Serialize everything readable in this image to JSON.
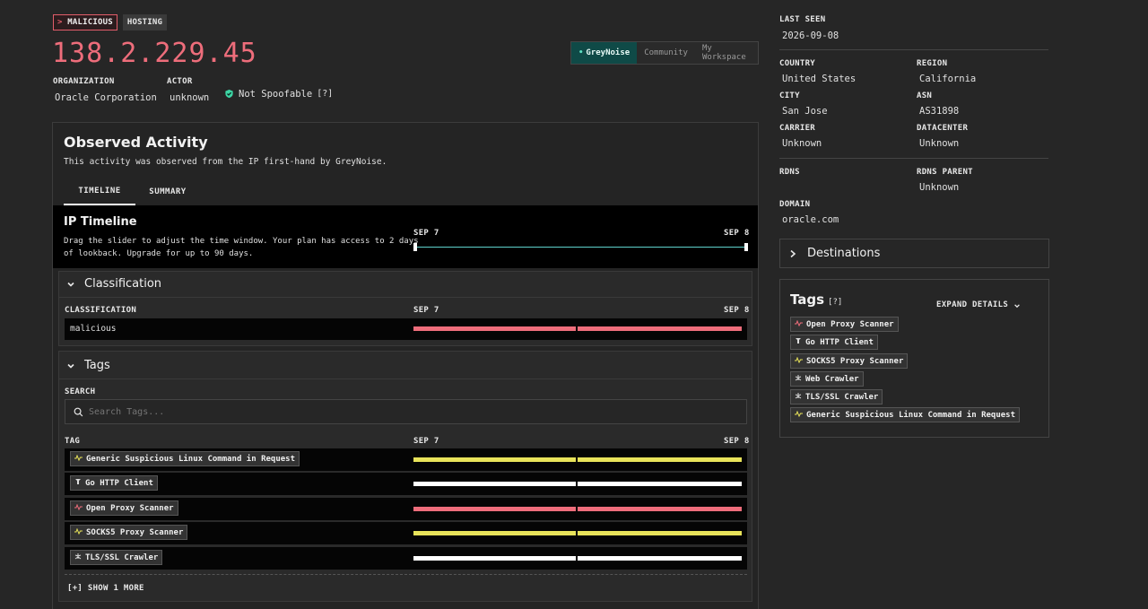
{
  "badges": {
    "malicious": "MALICIOUS",
    "malicious_prefix": ">",
    "hosting": "HOSTING"
  },
  "ip": "138.2.229.45",
  "sources": {
    "greynoise": "GreyNoise",
    "community": "Community",
    "workspace": "My Workspace",
    "active": "GreyNoise"
  },
  "organization": {
    "label": "ORGANIZATION",
    "value": "Oracle Corporation"
  },
  "actor": {
    "label": "ACTOR",
    "value": "unknown"
  },
  "spoofable": {
    "label": "Not Spoofable",
    "help": "[?]"
  },
  "observed": {
    "title": "Observed Activity",
    "subtitle": "This activity was observed from the IP first-hand by GreyNoise.",
    "tabs": [
      "TIMELINE",
      "SUMMARY"
    ]
  },
  "timeline": {
    "title": "IP Timeline",
    "desc_line1": "Drag the slider to adjust the time window. Your plan has access to 2 days",
    "desc_line2": "of lookback. Upgrade for up to 90 days.",
    "start": "SEP 7",
    "end": "SEP 8"
  },
  "classification": {
    "section_title": "Classification",
    "col_label": "CLASSIFICATION",
    "start": "SEP 7",
    "end": "SEP 8",
    "value": "malicious"
  },
  "tags_section": {
    "title": "Tags",
    "search_label": "SEARCH",
    "search_placeholder": "Search Tags...",
    "col_label": "TAG",
    "start": "SEP 7",
    "end": "SEP 8",
    "rows": [
      {
        "name": "Generic Suspicious Linux Command in Request",
        "color": "#e8e35a",
        "icon": "activity-icon"
      },
      {
        "name": "Go HTTP Client",
        "color": "#ffffff",
        "icon": "tool-icon"
      },
      {
        "name": "Open Proxy Scanner",
        "color": "#ee6d7b",
        "icon": "pulse-icon"
      },
      {
        "name": "SOCKS5 Proxy Scanner",
        "color": "#e8e35a",
        "icon": "activity-icon"
      },
      {
        "name": "TLS/SSL Crawler",
        "color": "#ffffff",
        "icon": "spider-icon"
      }
    ],
    "show_more": "[+] SHOW 1 MORE"
  },
  "right": {
    "last_seen": {
      "label": "LAST SEEN",
      "value": "2026-09-08"
    },
    "country": {
      "label": "COUNTRY",
      "value": "United States"
    },
    "region": {
      "label": "REGION",
      "value": "California"
    },
    "city": {
      "label": "CITY",
      "value": "San Jose"
    },
    "asn": {
      "label": "ASN",
      "value": "AS31898"
    },
    "carrier": {
      "label": "CARRIER",
      "value": "Unknown"
    },
    "datacenter": {
      "label": "DATACENTER",
      "value": "Unknown"
    },
    "rdns": {
      "label": "RDNS",
      "value": ""
    },
    "rdns_parent": {
      "label": "RDNS PARENT",
      "value": "Unknown"
    },
    "domain": {
      "label": "DOMAIN",
      "value": "oracle.com"
    },
    "destinations": "Destinations",
    "tags": {
      "title": "Tags",
      "help": "[?]",
      "expand": "EXPAND DETAILS",
      "items": [
        {
          "name": "Open Proxy Scanner",
          "icon": "pulse-icon"
        },
        {
          "name": "Go HTTP Client",
          "icon": "tool-icon"
        },
        {
          "name": "SOCKS5 Proxy Scanner",
          "icon": "activity-icon"
        },
        {
          "name": "Web Crawler",
          "icon": "spider-icon"
        },
        {
          "name": "TLS/SSL Crawler",
          "icon": "spider-icon"
        },
        {
          "name": "Generic Suspicious Linux Command in Request",
          "icon": "activity-icon"
        }
      ]
    }
  },
  "colors": {
    "malicious": "#ee6d7b",
    "accent": "#0f4a47",
    "suspicious": "#e8e35a"
  }
}
